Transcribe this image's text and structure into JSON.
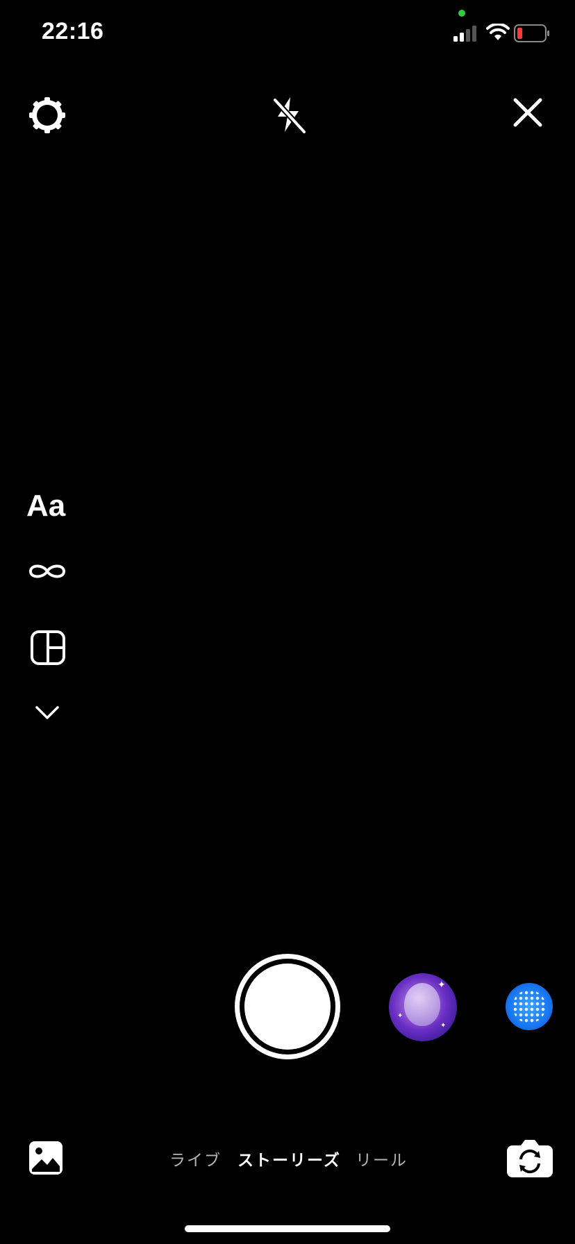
{
  "status_bar": {
    "time": "22:16"
  },
  "top_bar": {
    "settings_icon": "gear-icon",
    "flash_icon": "flash-off-icon",
    "close_icon": "close-icon"
  },
  "side_tools": {
    "text_label": "Aa",
    "boomerang_icon": "infinity-icon",
    "layout_icon": "layout-icon",
    "more_icon": "chevron-down-icon"
  },
  "capture": {
    "effects": [
      "balloon-effect",
      "sparkle-effect"
    ]
  },
  "bottom_bar": {
    "modes": [
      "ライブ",
      "ストーリーズ",
      "リール"
    ],
    "selected_mode": "ストーリーズ"
  },
  "colors": {
    "background": "#000000",
    "foreground": "#ffffff",
    "inactive_mode": "#b5b5b5",
    "battery_low": "#ff3b30",
    "camera_indicator": "#2ecc40"
  }
}
